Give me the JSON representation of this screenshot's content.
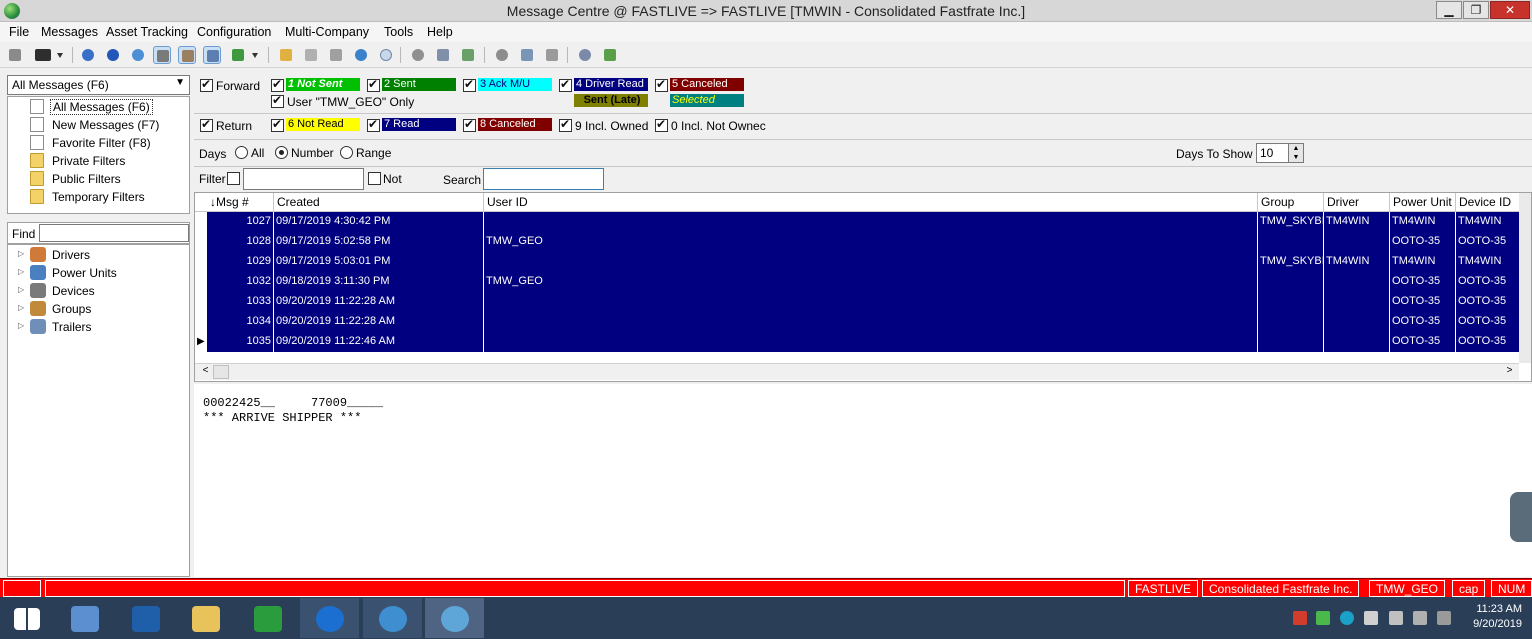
{
  "window": {
    "title": "Message Centre @ FASTLIVE => FASTLIVE [TMWIN - Consolidated Fastfrate Inc.]",
    "minimize": "▁",
    "maximize": "❐",
    "close": "✕"
  },
  "menu": [
    "File",
    "Messages",
    "Asset Tracking",
    "Configuration",
    "Multi-Company",
    "Tools",
    "Help"
  ],
  "left": {
    "folder_select": "All Messages (F6)",
    "folders": [
      {
        "label": "All Messages (F6)",
        "icon": "document-icon"
      },
      {
        "label": "New Messages (F7)",
        "icon": "document-icon"
      },
      {
        "label": "Favorite Filter (F8)",
        "icon": "document-icon"
      },
      {
        "label": "Private Filters",
        "icon": "folder-icon"
      },
      {
        "label": "Public Filters",
        "icon": "folder-icon"
      },
      {
        "label": "Temporary Filters",
        "icon": "folder-icon"
      }
    ],
    "find_label": "Find",
    "assets": [
      {
        "label": "Drivers",
        "icon": "driver-icon"
      },
      {
        "label": "Power Units",
        "icon": "truck-icon"
      },
      {
        "label": "Devices",
        "icon": "device-icon"
      },
      {
        "label": "Groups",
        "icon": "group-icon"
      },
      {
        "label": "Trailers",
        "icon": "trailer-icon"
      }
    ]
  },
  "filters": {
    "forward": "Forward",
    "return": "Return",
    "user_only": "User \"TMW_GEO\" Only",
    "statuses": {
      "not_sent": "1 Not Sent",
      "sent": "2 Sent",
      "ack": "3 Ack M/U",
      "driver_read": "4 Driver Read",
      "canceled5": "5 Canceled",
      "sent_late": "Sent (Late)",
      "selected": "Selected",
      "not_read": "6 Not Read",
      "read": "7 Read",
      "canceled8": "8 Canceled",
      "incl_owned": "9 Incl. Owned",
      "incl_not_owned": "0 Incl. Not Ownec"
    },
    "colors": {
      "not_sent": "#00c000",
      "sent": "#008000",
      "ack": "#00ffff",
      "driver_read": "#000080",
      "canceled5": "#800000",
      "sent_late": "#808000",
      "selected": "#008080",
      "not_read": "#ffff00",
      "read": "#000080",
      "canceled8": "#800000"
    },
    "days_label": "Days",
    "days_options": [
      "All",
      "Number",
      "Range"
    ],
    "days_selected": "Number",
    "days_to_show_label": "Days To Show",
    "days_to_show_value": "10",
    "filter_label": "Filter",
    "not_label": "Not",
    "search_label": "Search"
  },
  "grid": {
    "columns": [
      "Msg #",
      "Created",
      "User ID",
      "Group",
      "Driver",
      "Power Unit",
      "Device ID"
    ],
    "sort_indicator": "↓",
    "rows": [
      {
        "msg": "1027",
        "created": "09/17/2019 4:30:42 PM",
        "user": "",
        "group": "TMW_SKYBIT",
        "driver": "TM4WIN",
        "unit": "TM4WIN",
        "device": "TM4WIN"
      },
      {
        "msg": "1028",
        "created": "09/17/2019 5:02:58 PM",
        "user": "TMW_GEO",
        "group": "",
        "driver": "",
        "unit": "OOTO-35",
        "device": "OOTO-35"
      },
      {
        "msg": "1029",
        "created": "09/17/2019 5:03:01 PM",
        "user": "",
        "group": "TMW_SKYBIT",
        "driver": "TM4WIN",
        "unit": "TM4WIN",
        "device": "TM4WIN"
      },
      {
        "msg": "1032",
        "created": "09/18/2019 3:11:30 PM",
        "user": "TMW_GEO",
        "group": "",
        "driver": "",
        "unit": "OOTO-35",
        "device": "OOTO-35"
      },
      {
        "msg": "1033",
        "created": "09/20/2019 11:22:28 AM",
        "user": "",
        "group": "",
        "driver": "",
        "unit": "OOTO-35",
        "device": "OOTO-35"
      },
      {
        "msg": "1034",
        "created": "09/20/2019 11:22:28 AM",
        "user": "",
        "group": "",
        "driver": "",
        "unit": "OOTO-35",
        "device": "OOTO-35"
      },
      {
        "msg": "1035",
        "created": "09/20/2019 11:22:46 AM",
        "user": "",
        "group": "",
        "driver": "",
        "unit": "OOTO-35",
        "device": "OOTO-35"
      }
    ],
    "current_row_marker": "▶",
    "selection_color": "#000080"
  },
  "message": {
    "line1": "00022425__     77009_____",
    "line2": "*** ARRIVE SHIPPER ***"
  },
  "status": {
    "server": "FASTLIVE",
    "company": "Consolidated Fastfrate Inc.",
    "user": "TMW_GEO",
    "cap": "cap",
    "num": "NUM",
    "color": "#ff0000"
  },
  "taskbar": {
    "time": "11:23 AM",
    "date": "9/20/2019",
    "apps": [
      "start-icon",
      "server-manager-icon",
      "powershell-icon",
      "file-explorer-icon",
      "store-icon",
      "teamviewer-icon",
      "globe-app-icon",
      "message-centre-icon"
    ]
  }
}
